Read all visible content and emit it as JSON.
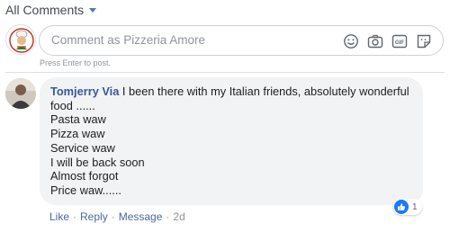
{
  "filter": {
    "label": "All Comments"
  },
  "composer": {
    "placeholder": "Comment as Pizzeria Amore",
    "hint": "Press Enter to post.",
    "icons": [
      "emoji-icon",
      "camera-icon",
      "gif-icon",
      "sticker-icon"
    ],
    "gif_text": "GIF"
  },
  "comment": {
    "author": "Tomjerry Via",
    "lines": [
      "I been there with my Italian friends, absolutely wonderful",
      "food ......",
      "Pasta waw",
      "Pizza waw",
      "Service waw",
      "I will be back soon",
      "Almost forgot",
      "Price waw......"
    ],
    "reaction_count": "1",
    "actions": {
      "like": "Like",
      "reply": "Reply",
      "message": "Message",
      "time": "2d"
    }
  },
  "colors": {
    "link": "#385898",
    "bubble": "#f2f3f5",
    "like_blue": "#2078f4"
  }
}
